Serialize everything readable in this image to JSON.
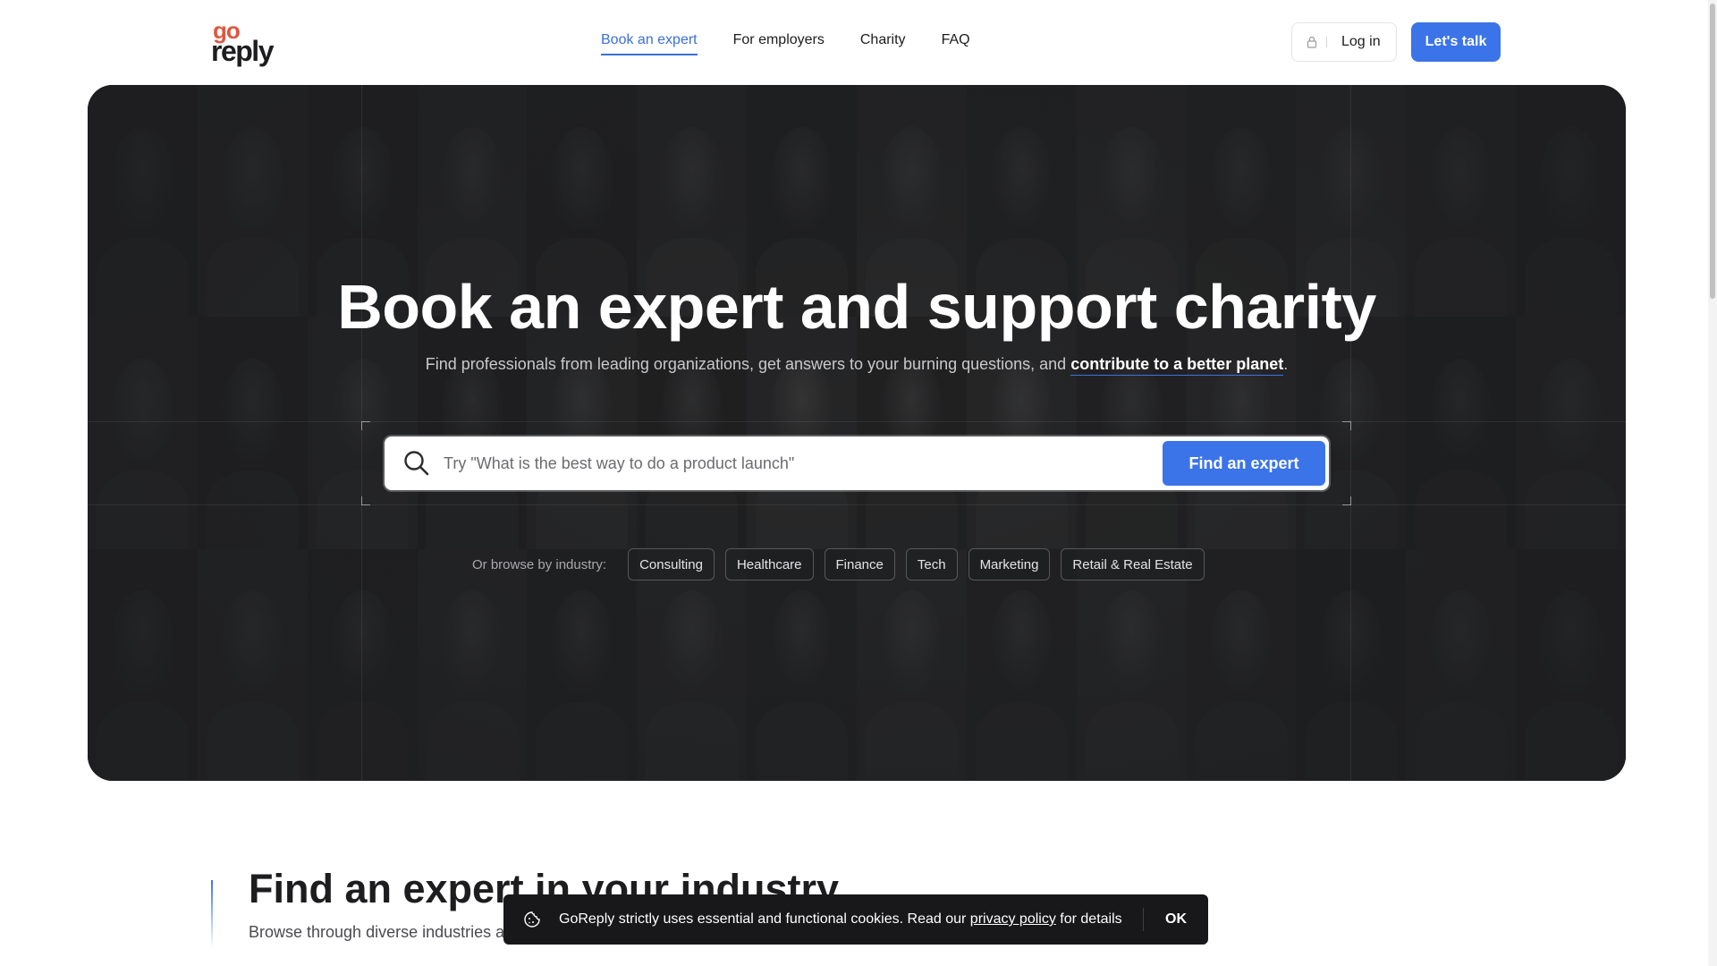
{
  "header": {
    "logo_top": "go",
    "logo_bottom": "reply",
    "nav": [
      {
        "label": "Book an expert"
      },
      {
        "label": "For employers"
      },
      {
        "label": "Charity"
      },
      {
        "label": "FAQ"
      }
    ],
    "login_label": "Log in",
    "cta_label": "Let's talk"
  },
  "hero": {
    "title": "Book an expert and support charity",
    "subtitle_prefix": "Find professionals from leading organizations, get answers to your burning questions, and ",
    "subtitle_link": "contribute to a better planet",
    "subtitle_suffix": ".",
    "search_placeholder": "Try \"What is the best way to do a product launch\"",
    "search_button": "Find an expert",
    "browse_label": "Or browse by industry:",
    "industries": [
      "Consulting",
      "Healthcare",
      "Finance",
      "Tech",
      "Marketing",
      "Retail & Real Estate"
    ]
  },
  "section": {
    "title": "Find an expert in your industry",
    "subtitle": "Browse through diverse industries a"
  },
  "cookie": {
    "text_prefix": "GoReply strictly uses essential and functional cookies. Read our ",
    "link": "privacy policy",
    "text_suffix": " for details",
    "ok": "OK"
  },
  "colors": {
    "accent": "#3b73e8",
    "logo_go": "#e2553f",
    "hero_bg": "#1e1f21",
    "cookie_bg": "#18181b"
  },
  "icons": {
    "lock": "lock-icon",
    "search": "search-icon",
    "cookie": "cookie-icon"
  }
}
